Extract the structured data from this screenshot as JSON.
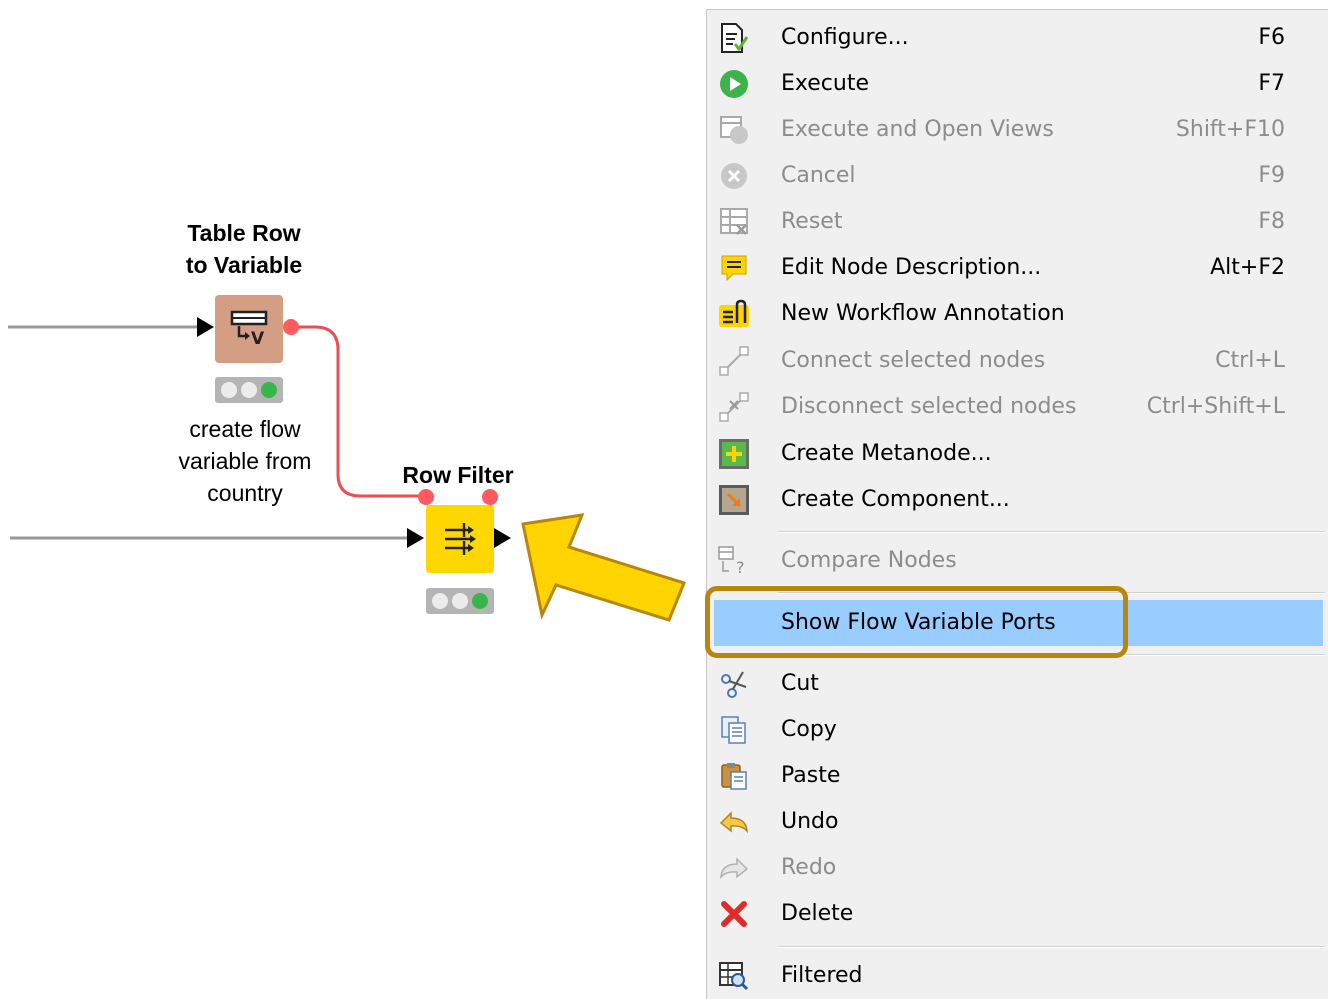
{
  "canvas": {
    "nodes": [
      {
        "title": "Table Row\nto Variable",
        "annotation": "create flow\nvariable from\ncountry",
        "color": "#d39e84"
      },
      {
        "title": "Row Filter",
        "annotation": "",
        "color": "#ffd700"
      }
    ],
    "flow_connection_color": "#ea4f57",
    "data_connection_color": "#999999",
    "arrow_color": "#ffd600",
    "highlight_border_color": "#b8860b"
  },
  "menu": {
    "items": [
      {
        "label": "Configure...",
        "shortcut": "F6",
        "icon": "configure-icon",
        "enabled": true
      },
      {
        "label": "Execute",
        "shortcut": "F7",
        "icon": "execute-icon",
        "enabled": true
      },
      {
        "label": "Execute and Open Views",
        "shortcut": "Shift+F10",
        "icon": "execute-open-views-icon",
        "enabled": false
      },
      {
        "label": "Cancel",
        "shortcut": "F9",
        "icon": "cancel-icon",
        "enabled": false
      },
      {
        "label": "Reset",
        "shortcut": "F8",
        "icon": "reset-icon",
        "enabled": false
      },
      {
        "label": "Edit Node Description...",
        "shortcut": "Alt+F2",
        "icon": "edit-description-icon",
        "enabled": true
      },
      {
        "label": "New Workflow Annotation",
        "shortcut": "",
        "icon": "annotation-icon",
        "enabled": true
      },
      {
        "label": "Connect selected nodes",
        "shortcut": "Ctrl+L",
        "icon": "connect-icon",
        "enabled": false
      },
      {
        "label": "Disconnect selected nodes",
        "shortcut": "Ctrl+Shift+L",
        "icon": "disconnect-icon",
        "enabled": false
      },
      {
        "label": "Create Metanode...",
        "shortcut": "",
        "icon": "metanode-icon",
        "enabled": true
      },
      {
        "label": "Create Component...",
        "shortcut": "",
        "icon": "component-icon",
        "enabled": true
      },
      {
        "label": "Compare Nodes",
        "shortcut": "",
        "icon": "compare-icon",
        "enabled": false
      },
      {
        "label": "Show Flow Variable Ports",
        "shortcut": "",
        "icon": "",
        "enabled": true,
        "highlighted": true
      },
      {
        "label": "Cut",
        "shortcut": "",
        "icon": "scissors-icon",
        "enabled": true
      },
      {
        "label": "Copy",
        "shortcut": "",
        "icon": "copy-icon",
        "enabled": true
      },
      {
        "label": "Paste",
        "shortcut": "",
        "icon": "paste-icon",
        "enabled": true
      },
      {
        "label": "Undo",
        "shortcut": "",
        "icon": "undo-icon",
        "enabled": true
      },
      {
        "label": "Redo",
        "shortcut": "",
        "icon": "redo-icon",
        "enabled": false
      },
      {
        "label": "Delete",
        "shortcut": "",
        "icon": "delete-icon",
        "enabled": true
      },
      {
        "label": "Filtered",
        "shortcut": "",
        "icon": "filtered-icon",
        "enabled": true
      }
    ],
    "highlight_color": "#99ccff"
  }
}
